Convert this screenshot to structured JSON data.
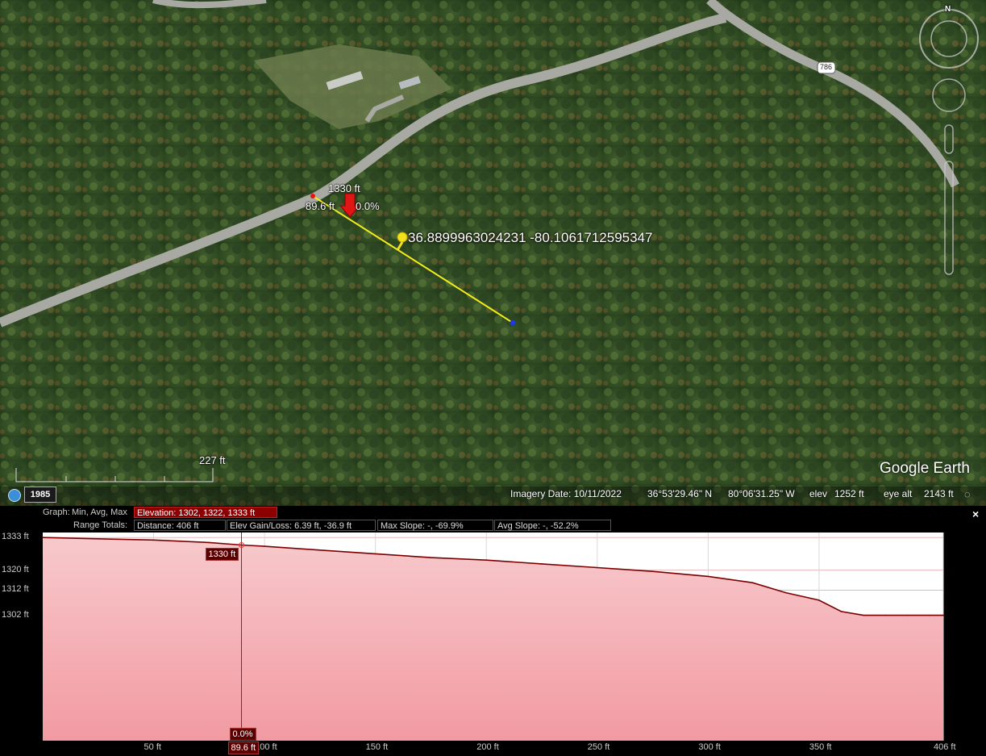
{
  "map": {
    "road_label": "786",
    "start_elevation": "1330 ft",
    "start_distance": "89.6 ft",
    "start_slope": "0.0%",
    "pin_coordinates": "36.8899963024231 -80.1061712595347",
    "scale_label": "227 ft",
    "history_year": "1985",
    "compass_north": "N",
    "logo": "Google Earth"
  },
  "status": {
    "imagery_date": "Imagery Date: 10/11/2022",
    "latitude": "36°53'29.46\" N",
    "longitude": "80°06'31.25\" W",
    "elev_label": "elev",
    "elev_value": "1252 ft",
    "eye_alt_label": "eye alt",
    "eye_alt_value": "2143 ft"
  },
  "profile": {
    "graph_label": "Graph:",
    "graph_mode": "Min, Avg, Max",
    "elevation_stats": "Elevation: 1302, 1322, 1333 ft",
    "range_totals_label": "Range Totals:",
    "distance": "Distance: 406 ft",
    "elev_gain_loss": "Elev Gain/Loss: 6.39 ft, -36.9 ft",
    "max_slope": "Max Slope: -, -69.9%",
    "avg_slope": "Avg Slope: -, -52.2%",
    "close": "×",
    "cursor_elevation": "1330 ft",
    "cursor_slope": "0.0%",
    "cursor_distance": "89.6 ft"
  },
  "chart_data": {
    "type": "area",
    "title": "",
    "xlabel": "",
    "ylabel": "",
    "x_unit": "ft",
    "y_unit": "ft",
    "xlim": [
      0,
      406
    ],
    "ylim": [
      1252,
      1335
    ],
    "y_ticks": [
      "1333 ft",
      "1320 ft",
      "1312 ft",
      "1302 ft"
    ],
    "y_tick_values": [
      1333,
      1320,
      1312,
      1302
    ],
    "x_ticks": [
      "50 ft",
      "100 ft",
      "150 ft",
      "200 ft",
      "250 ft",
      "300 ft",
      "350 ft",
      "406 ft"
    ],
    "x_tick_values": [
      50,
      100,
      150,
      200,
      250,
      300,
      350,
      406
    ],
    "grid": true,
    "cursor_x": 89.6,
    "series": [
      {
        "x": [
          0,
          25,
          50,
          75,
          89.6,
          100,
          125,
          150,
          175,
          200,
          225,
          250,
          275,
          300,
          320,
          335,
          350,
          360,
          370,
          380,
          390,
          400,
          406
        ],
        "values": [
          1333,
          1332.5,
          1332,
          1331,
          1330,
          1329.5,
          1328,
          1326.5,
          1325,
          1324,
          1322.5,
          1321,
          1319.5,
          1317.5,
          1315,
          1311,
          1308,
          1303.5,
          1302,
          1302,
          1302,
          1302,
          1302
        ]
      }
    ],
    "colors": {
      "line": "#7a0000",
      "fill_top": "#f7c9cc",
      "fill_bottom": "#f29aa2",
      "grid": "#e6b6b9"
    }
  }
}
